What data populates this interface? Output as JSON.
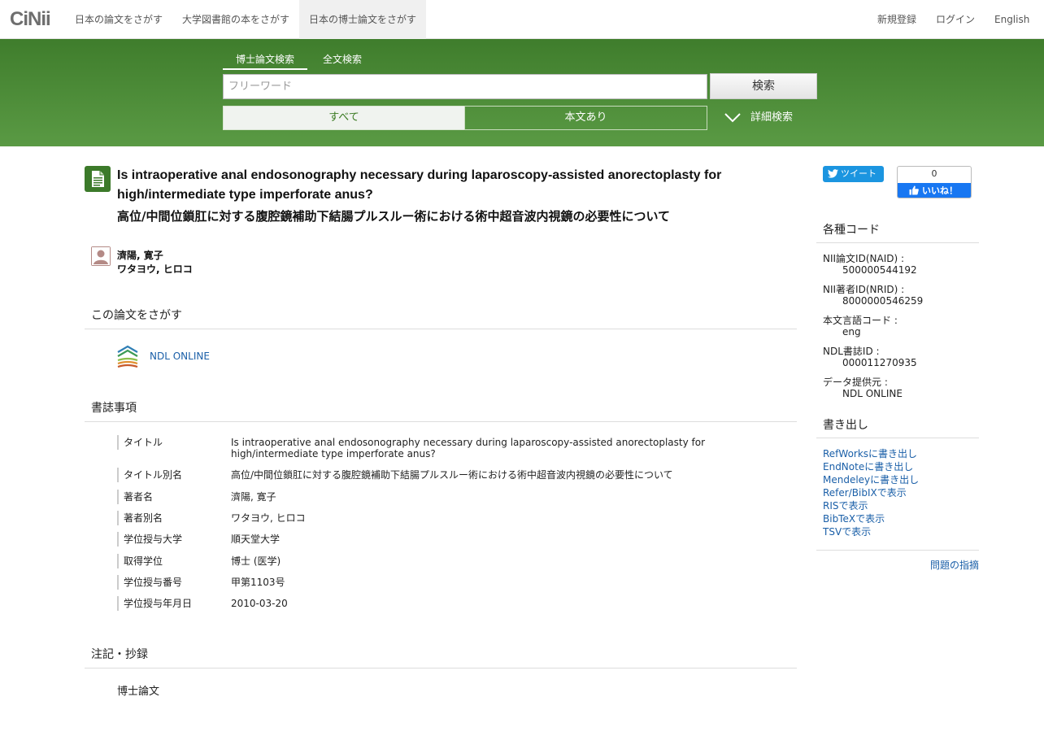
{
  "nav": {
    "logo": "CiNii",
    "tabs": [
      "日本の論文をさがす",
      "大学図書館の本をさがす",
      "日本の博士論文をさがす"
    ],
    "right": [
      "新規登録",
      "ログイン",
      "English"
    ]
  },
  "search": {
    "tabs": [
      "博士論文検索",
      "全文検索"
    ],
    "placeholder": "フリーワード",
    "button": "検索",
    "toggle_all": "すべて",
    "toggle_full": "本文あり",
    "advanced": "詳細検索"
  },
  "article": {
    "title_en": "Is intraoperative anal endosonography necessary during laparoscopy-assisted anorectoplasty for high/intermediate type imperforate anus?",
    "title_ja": "高位/中間位鎖肛に対する腹腔鏡補助下結腸プルスルー術における術中超音波内視鏡の必要性について",
    "author_name": "濟陽, 寛子",
    "author_kana": "ワタヨウ, ヒロコ"
  },
  "sections": {
    "find": "この論文をさがす",
    "ndl_link": "NDL ONLINE",
    "biblio": "書誌事項",
    "notes": "注記・抄録",
    "note_text": "博士論文"
  },
  "biblio_rows": [
    {
      "label": "タイトル",
      "value": "Is intraoperative anal endosonography necessary during laparoscopy-assisted anorectoplasty for high/intermediate type imperforate anus?"
    },
    {
      "label": "タイトル別名",
      "value": "高位/中間位鎖肛に対する腹腔鏡補助下結腸プルスルー術における術中超音波内視鏡の必要性について"
    },
    {
      "label": "著者名",
      "value": "濟陽, 寛子"
    },
    {
      "label": "著者別名",
      "value": "ワタヨウ, ヒロコ"
    },
    {
      "label": "学位授与大学",
      "value": "順天堂大学"
    },
    {
      "label": "取得学位",
      "value": "博士 (医学)"
    },
    {
      "label": "学位授与番号",
      "value": "甲第1103号"
    },
    {
      "label": "学位授与年月日",
      "value": "2010-03-20"
    }
  ],
  "social": {
    "tweet": "ツイート",
    "fb_count": "0",
    "fb_like": "いいね！"
  },
  "sidebar": {
    "codes_head": "各種コード",
    "codes": [
      {
        "label": "NII論文ID(NAID) :",
        "value": "500000544192"
      },
      {
        "label": "NII著者ID(NRID) :",
        "value": "8000000546259"
      },
      {
        "label": "本文言語コード :",
        "value": "eng"
      },
      {
        "label": "NDL書誌ID :",
        "value": "000011270935"
      },
      {
        "label": "データ提供元 :",
        "value": "NDL ONLINE"
      }
    ],
    "export_head": "書き出し",
    "exports": [
      "RefWorksに書き出し",
      "EndNoteに書き出し",
      "Mendeleyに書き出し",
      "Refer/BibIXで表示",
      "RISで表示",
      "BibTeXで表示",
      "TSVで表示"
    ],
    "report": "問題の指摘"
  },
  "colors": {
    "brand_green": "#3f7d2c",
    "link_blue": "#1a5fa8"
  }
}
